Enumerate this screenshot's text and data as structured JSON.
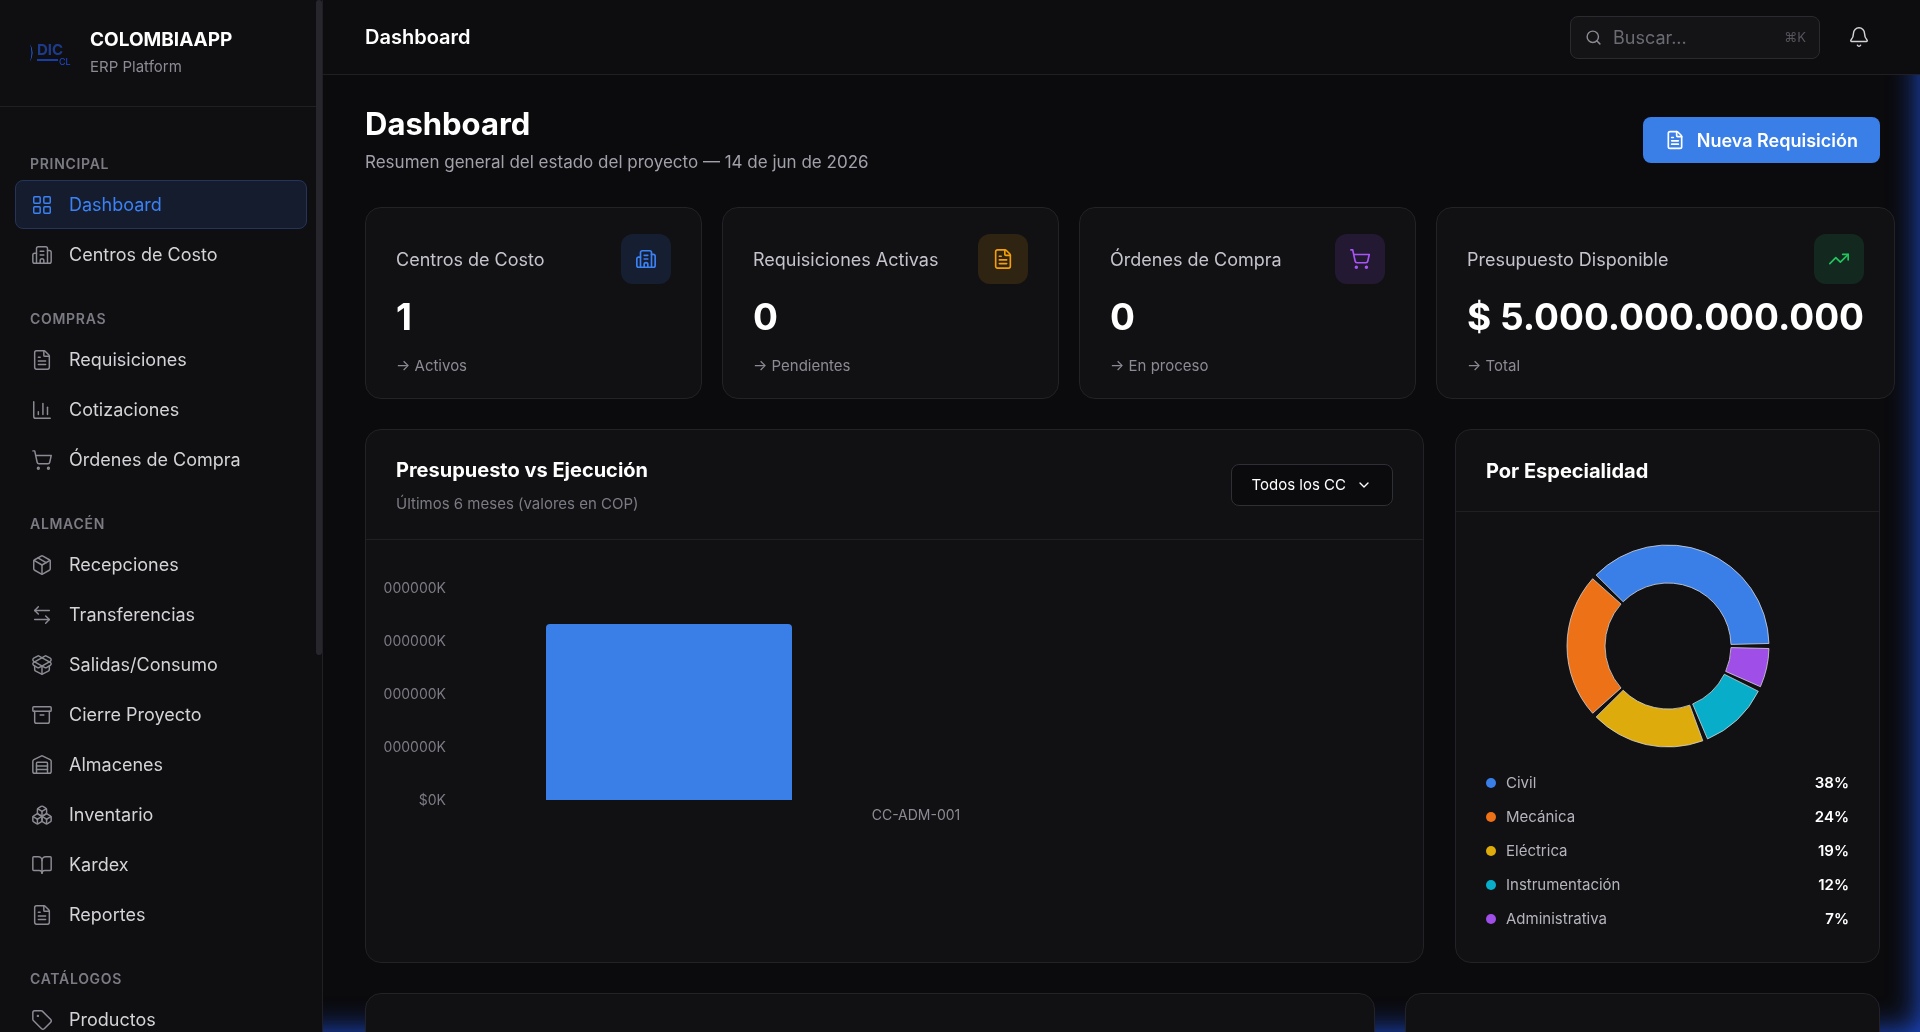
{
  "brand": {
    "logo_text": "DIC",
    "logo_sub": "CL",
    "name": "COLOMBIAAPP",
    "tagline": "ERP Platform"
  },
  "sidebar": {
    "sections": [
      {
        "title": "PRINCIPAL",
        "items": [
          {
            "label": "Dashboard",
            "selected": true
          },
          {
            "label": "Centros de Costo",
            "selected": false
          }
        ]
      },
      {
        "title": "COMPRAS",
        "items": [
          {
            "label": "Requisiciones",
            "selected": false
          },
          {
            "label": "Cotizaciones",
            "selected": false
          },
          {
            "label": "Órdenes de Compra",
            "selected": false
          }
        ]
      },
      {
        "title": "ALMACÉN",
        "items": [
          {
            "label": "Recepciones",
            "selected": false
          },
          {
            "label": "Transferencias",
            "selected": false
          },
          {
            "label": "Salidas/Consumo",
            "selected": false
          },
          {
            "label": "Cierre Proyecto",
            "selected": false
          },
          {
            "label": "Almacenes",
            "selected": false
          },
          {
            "label": "Inventario",
            "selected": false
          },
          {
            "label": "Kardex",
            "selected": false
          },
          {
            "label": "Reportes",
            "selected": false
          }
        ]
      },
      {
        "title": "CATÁLOGOS",
        "items": [
          {
            "label": "Productos",
            "selected": false
          }
        ]
      }
    ]
  },
  "header": {
    "title": "Dashboard",
    "search": {
      "placeholder": "Buscar...",
      "shortcut": "⌘K"
    }
  },
  "page": {
    "title": "Dashboard",
    "subtitle": "Resumen general del estado del proyecto — 14 de jun de 2026",
    "primary_button": "Nueva Requisición"
  },
  "stats": [
    {
      "label": "Centros de Costo",
      "value": "1",
      "note": "→ Activos",
      "color": "#3b82f6"
    },
    {
      "label": "Requisiciones Activas",
      "value": "0",
      "note": "→ Pendientes",
      "color": "#f59e0b"
    },
    {
      "label": "Órdenes de Compra",
      "value": "0",
      "note": "→ En proceso",
      "color": "#a855f7"
    },
    {
      "label": "Presupuesto Disponible",
      "value": "$ 5.000.000.000.000",
      "note": "→ Total",
      "color": "#22c55e"
    }
  ],
  "budget_chart": {
    "title": "Presupuesto vs Ejecución",
    "subtitle": "Últimos 6 meses (valores en COP)",
    "filter": "Todos los CC",
    "y_axis_labels": [
      "000000K",
      "000000K",
      "000000K",
      "000000K",
      "$0K"
    ],
    "x_axis_label": "CC-ADM-001"
  },
  "specialty": {
    "title": "Por Especialidad",
    "chart_data": {
      "type": "donut",
      "categories": [
        "Civil",
        "Mecánica",
        "Eléctrica",
        "Instrumentación",
        "Administrativa"
      ],
      "values": [
        38,
        24,
        19,
        12,
        7
      ]
    },
    "legend": [
      {
        "value": "38%",
        "color": "#3a7ee8"
      },
      {
        "value": "24%",
        "color": "#ec7117"
      },
      {
        "value": "19%",
        "color": "#ddab0b"
      },
      {
        "value": "12%",
        "color": "#08adc9"
      },
      {
        "value": "7%",
        "color": "#a04ee8"
      }
    ]
  }
}
